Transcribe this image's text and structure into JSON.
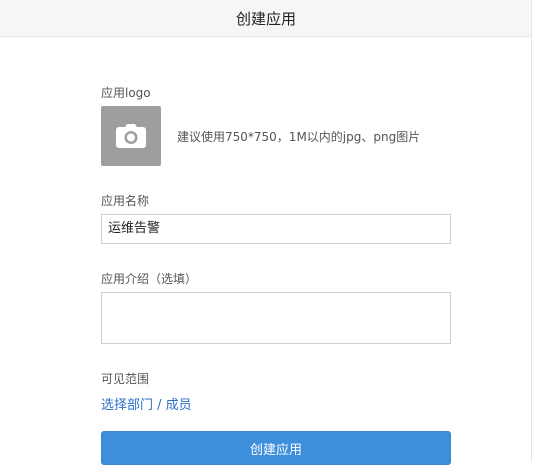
{
  "header": {
    "title": "创建应用"
  },
  "form": {
    "logo_label": "应用logo",
    "logo_hint": "建议使用750*750，1M以内的jpg、png图片",
    "logo_icon": "camera-icon",
    "name_label": "应用名称",
    "name_value": "运维告警",
    "desc_label": "应用介绍（选填）",
    "desc_value": "",
    "scope_label": "可见范围",
    "scope_link": "选择部门 / 成员",
    "submit_label": "创建应用"
  },
  "colors": {
    "header_bg": "#f6f6f6",
    "logo_bg": "#9e9e9e",
    "link": "#2a6fc9",
    "primary_button": "#3d8edb"
  }
}
